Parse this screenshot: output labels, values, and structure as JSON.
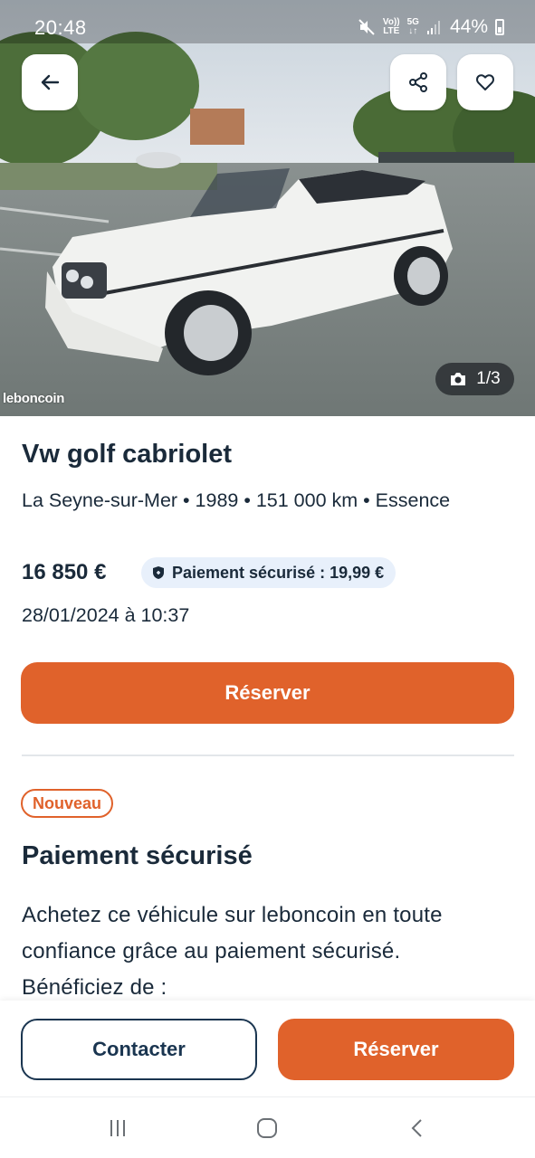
{
  "status_bar": {
    "time": "20:48",
    "network_top": "Vo))",
    "network_bottom": "LTE",
    "gen_top": "5G",
    "gen_bottom": "↓↑",
    "battery": "44%"
  },
  "gallery": {
    "watermark": "leboncoin",
    "counter": "1/3"
  },
  "listing": {
    "title": "Vw golf cabriolet",
    "meta": "La Seyne-sur-Mer • 1989 • 151 000 km • Essence",
    "price": "16 850 €",
    "secure_payment_badge": "Paiement sécurisé : 19,99 €",
    "date": "28/01/2024 à 10:37",
    "reserve_label": "Réserver"
  },
  "secure_section": {
    "badge": "Nouveau",
    "title": "Paiement sécurisé",
    "text": "Achetez ce véhicule sur leboncoin en toute confiance grâce au paiement sécurisé. Bénéficiez de :"
  },
  "bottom_bar": {
    "contact_label": "Contacter",
    "reserve_label": "Réserver"
  },
  "colors": {
    "accent": "#e0622b",
    "text": "#1a2a3a",
    "badge_bg": "#e8f0fb",
    "outline": "#1a3550"
  },
  "icons": [
    "back-arrow-icon",
    "share-icon",
    "heart-icon",
    "camera-icon",
    "shield-icon",
    "recent-apps-icon",
    "home-icon",
    "back-nav-icon",
    "mute-icon",
    "signal-icon",
    "battery-icon"
  ]
}
